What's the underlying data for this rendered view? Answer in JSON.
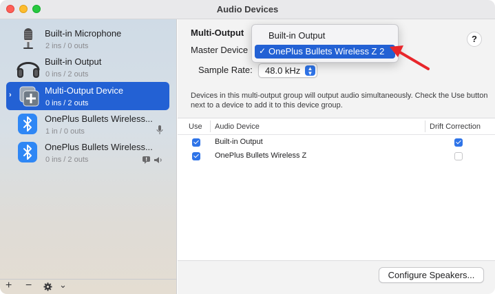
{
  "window": {
    "title": "Audio Devices"
  },
  "sidebar": {
    "devices": [
      {
        "name": "Built-in Microphone",
        "sub": "2 ins / 0 outs",
        "icon": "microphone-icon"
      },
      {
        "name": "Built-in Output",
        "sub": "0 ins / 2 outs",
        "icon": "headphones-icon"
      },
      {
        "name": "Multi-Output Device",
        "sub": "0 ins / 2 outs",
        "icon": "multi-output-icon",
        "selected": true
      },
      {
        "name": "OnePlus Bullets Wireless...",
        "sub": "1 in / 0 outs",
        "icon": "bluetooth-icon"
      },
      {
        "name": "OnePlus Bullets Wireless...",
        "sub": "0 ins / 2 outs",
        "icon": "bluetooth-icon"
      }
    ],
    "footer": {
      "add": "+",
      "remove": "−",
      "chevron": "⌄"
    }
  },
  "main": {
    "group_title": "Multi-Output",
    "master_label": "Master Device",
    "sample_rate_label": "Sample Rate:",
    "sample_rate_value": "48.0 kHz",
    "help": "?",
    "description": "Devices in this multi-output group will output audio simultaneously. Check the Use button next to a device to add it to this device group.",
    "table": {
      "headers": {
        "use": "Use",
        "device": "Audio Device",
        "drift": "Drift Correction"
      },
      "rows": [
        {
          "use": true,
          "device": "Built-in Output",
          "drift": true
        },
        {
          "use": true,
          "device": "OnePlus Bullets Wireless Z",
          "drift": false
        }
      ]
    },
    "configure_button": "Configure Speakers..."
  },
  "menu": {
    "items": [
      {
        "label": "Built-in Output",
        "selected": false
      },
      {
        "label": "OnePlus Bullets Wireless Z 2",
        "selected": true,
        "check": "✓"
      }
    ]
  },
  "colors": {
    "accent": "#2361d4",
    "annotation_arrow": "#e8262b"
  }
}
